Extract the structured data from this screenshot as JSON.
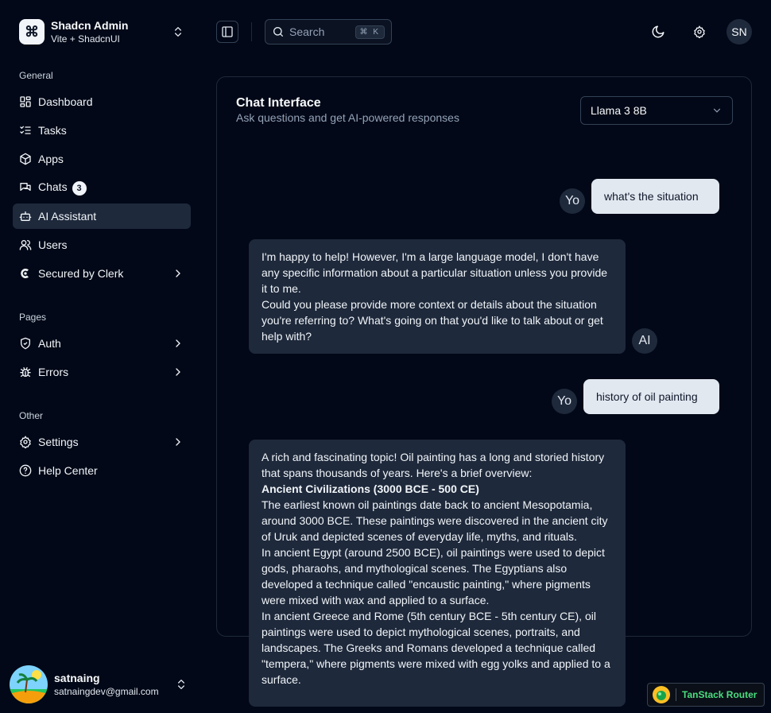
{
  "team": {
    "name": "Shadcn Admin",
    "plan": "Vite + ShadcnUI",
    "logo_glyph": "⌘"
  },
  "sidebar": {
    "general_label": "General",
    "general": [
      {
        "label": "Dashboard",
        "icon": "layout-dashboard-icon"
      },
      {
        "label": "Tasks",
        "icon": "list-checks-icon"
      },
      {
        "label": "Apps",
        "icon": "package-icon"
      },
      {
        "label": "Chats",
        "icon": "messages-icon",
        "badge": "3"
      },
      {
        "label": "AI Assistant",
        "icon": "robot-icon",
        "active": true
      },
      {
        "label": "Users",
        "icon": "users-icon"
      },
      {
        "label": "Secured by Clerk",
        "icon": "clerk-icon",
        "chevron": true
      }
    ],
    "pages_label": "Pages",
    "pages": [
      {
        "label": "Auth",
        "icon": "shield-check-icon",
        "chevron": true
      },
      {
        "label": "Errors",
        "icon": "bug-icon",
        "chevron": true
      }
    ],
    "other_label": "Other",
    "other": [
      {
        "label": "Settings",
        "icon": "settings-icon",
        "chevron": true
      },
      {
        "label": "Help Center",
        "icon": "help-circle-icon"
      }
    ]
  },
  "user": {
    "name": "satnaing",
    "email": "satnaingdev@gmail.com"
  },
  "header": {
    "search_label": "Search",
    "search_shortcut": "⌘ K",
    "profile_initials": "SN"
  },
  "chat": {
    "title": "Chat Interface",
    "subtitle": "Ask questions and get AI-powered responses",
    "model": "Llama 3 8B",
    "messages": [
      {
        "role": "user",
        "avatar": "Yo",
        "text": "what's the situation"
      },
      {
        "role": "ai",
        "avatar": "AI",
        "paragraphs": [
          "I'm happy to help! However, I'm a large language model, I don't have any specific information about a particular situation unless you provide it to me.",
          "Could you please provide more context or details about the situation you're referring to? What's going on that you'd like to talk about or get help with?"
        ]
      },
      {
        "role": "user",
        "avatar": "Yo",
        "text": "history of oil painting"
      },
      {
        "role": "ai",
        "paragraphs": [
          "A rich and fascinating topic! Oil painting has a long and storied history that spans thousands of years. Here's a brief overview:",
          "Ancient Civilizations (3000 BCE - 500 CE)",
          "The earliest known oil paintings date back to ancient Mesopotamia, around 3000 BCE. These paintings were discovered in the ancient city of Uruk and depicted scenes of everyday life, myths, and rituals.",
          "In ancient Egypt (around 2500 BCE), oil paintings were used to depict gods, pharaohs, and mythological scenes. The Egyptians also developed a technique called \"encaustic painting,\" where pigments were mixed with wax and applied to a surface.",
          "In ancient Greece and Rome (5th century BCE - 5th century CE), oil paintings were used to depict mythological scenes, portraits, and landscapes. The Greeks and Romans developed a technique called \"tempera,\" where pigments were mixed with egg yolks and applied to a surface."
        ]
      }
    ]
  },
  "devtools": {
    "label": "TanStack Router"
  },
  "colors": {
    "background": "#020817",
    "muted": "#1e293b",
    "user_bubble": "#e2e8f0",
    "accent_green": "#4ade80"
  }
}
